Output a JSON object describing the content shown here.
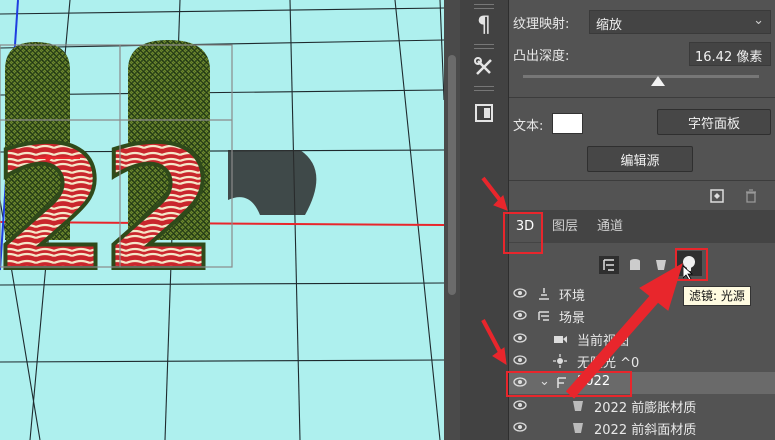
{
  "panel": {
    "texture_mapping_label": "纹理映射:",
    "texture_mapping_value": "缩放",
    "extrusion_depth_label": "凸出深度:",
    "extrusion_depth_value": "16.42 像素",
    "text_label": "文本:",
    "character_panel_button": "字符面板",
    "edit_source_button": "编辑源"
  },
  "tabs": [
    {
      "label": "3D"
    },
    {
      "label": "图层"
    },
    {
      "label": "通道"
    }
  ],
  "filter_tooltip": "滤镜: 光源",
  "scene_rows": [
    {
      "label": "环境",
      "icon": "environment-icon"
    },
    {
      "label": "场景",
      "icon": "scene-icon"
    },
    {
      "label": "当前视图",
      "icon": "camera-icon"
    },
    {
      "label": "无限光 ^0",
      "icon": "light-icon"
    },
    {
      "label": "2022",
      "icon": "mesh-icon"
    },
    {
      "label": "2022 前膨胀材质",
      "icon": "material-icon"
    },
    {
      "label": "2022 前斜面材质",
      "icon": "material-icon"
    }
  ],
  "viewport": {
    "text_3d": "22"
  },
  "colors": {
    "accent_red": "#e8262c",
    "panel_bg": "#535353",
    "viewport_bg": "#aef0ee"
  }
}
